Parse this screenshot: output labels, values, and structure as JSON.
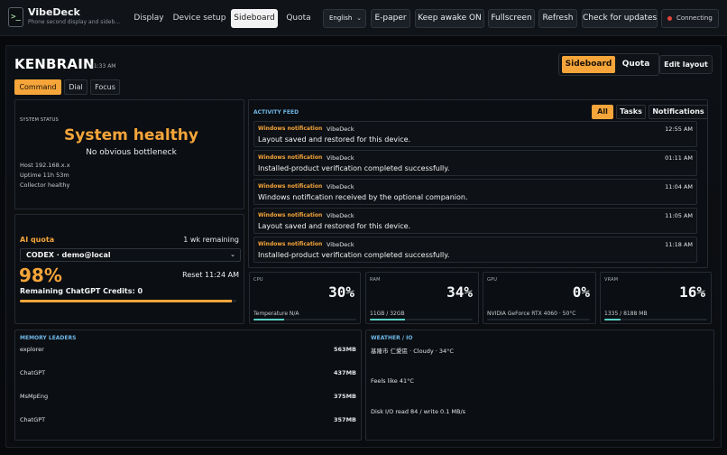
{
  "app": {
    "logo_glyph": ">_",
    "title": "VibeDeck",
    "subtitle": "Phone second display and sideb..."
  },
  "nav": {
    "items": [
      "Display",
      "Device setup",
      "Sideboard",
      "Quota"
    ],
    "active": "Sideboard"
  },
  "toolbar": {
    "language": "English",
    "epaper": "E-paper",
    "keep_awake": "Keep awake ON",
    "fullscreen": "Fullscreen",
    "refresh": "Refresh",
    "check_updates": "Check for updates",
    "connection_status": "Connecting",
    "connection_color": "#e0443a"
  },
  "header": {
    "device_name": "KENBRAIN",
    "time": "11:33 AM",
    "modes": [
      "Sideboard",
      "Quota"
    ],
    "active_mode": "Sideboard",
    "edit_layout": "Edit layout"
  },
  "subtabs": {
    "items": [
      "Command",
      "Dial",
      "Focus"
    ],
    "active": "Command"
  },
  "system_status": {
    "caption": "SYSTEM STATUS",
    "headline": "System healthy",
    "detail": "No obvious bottleneck",
    "host": "Host 192.168.x.x",
    "uptime": "Uptime 11h 53m",
    "collector": "Collector healthy"
  },
  "quota": {
    "title": "AI quota",
    "remaining": "1 wk remaining",
    "account": "CODEX · demo@local",
    "percent": "98%",
    "percent_value": 98,
    "reset": "Reset 11:24 AM",
    "credits": "Remaining ChatGPT Credits: 0"
  },
  "activity_feed": {
    "title": "ACTIVITY FEED",
    "filters": [
      "All",
      "Tasks",
      "Notifications"
    ],
    "active_filter": "All",
    "items": [
      {
        "source": "Windows notification",
        "app": "VibeDeck",
        "time": "12:55 AM",
        "message": "Layout saved and restored for this device."
      },
      {
        "source": "Windows notification",
        "app": "VibeDeck",
        "time": "01:11 AM",
        "message": "Installed-product verification completed successfully."
      },
      {
        "source": "Windows notification",
        "app": "VibeDeck",
        "time": "11:04 AM",
        "message": "Windows notification received by the optional companion."
      },
      {
        "source": "Windows notification",
        "app": "VibeDeck",
        "time": "11:05 AM",
        "message": "Layout saved and restored for this device."
      },
      {
        "source": "Windows notification",
        "app": "VibeDeck",
        "time": "11:18 AM",
        "message": "Installed-product verification completed successfully."
      }
    ]
  },
  "metrics": [
    {
      "label": "CPU",
      "value": "30%",
      "sub": "Temperature N/A",
      "level": 0.3
    },
    {
      "label": "RAM",
      "value": "34%",
      "sub": "11GB / 32GB",
      "level": 0.34
    },
    {
      "label": "GPU",
      "value": "0%",
      "sub": "NVIDIA GeForce RTX 4060 · 50°C",
      "level": 0.0
    },
    {
      "label": "VRAM",
      "value": "16%",
      "sub": "1335 / 8188 MB",
      "level": 0.16
    }
  ],
  "memory_leaders": {
    "title": "MEMORY LEADERS",
    "items": [
      {
        "name": "explorer",
        "value": "563MB"
      },
      {
        "name": "ChatGPT",
        "value": "437MB"
      },
      {
        "name": "MsMpEng",
        "value": "375MB"
      },
      {
        "name": "ChatGPT",
        "value": "357MB"
      }
    ]
  },
  "weather_io": {
    "title": "WEATHER / IO",
    "weather": "基隆市 仁愛區 · Cloudy · 34°C",
    "feels_like": "Feels like 41°C",
    "disk_io": "Disk I/O read 84 / write 0.1 MB/s"
  },
  "colors": {
    "accent": "#f5a53a",
    "section_title": "#6fb7e8",
    "meter": "#58d0c4"
  }
}
